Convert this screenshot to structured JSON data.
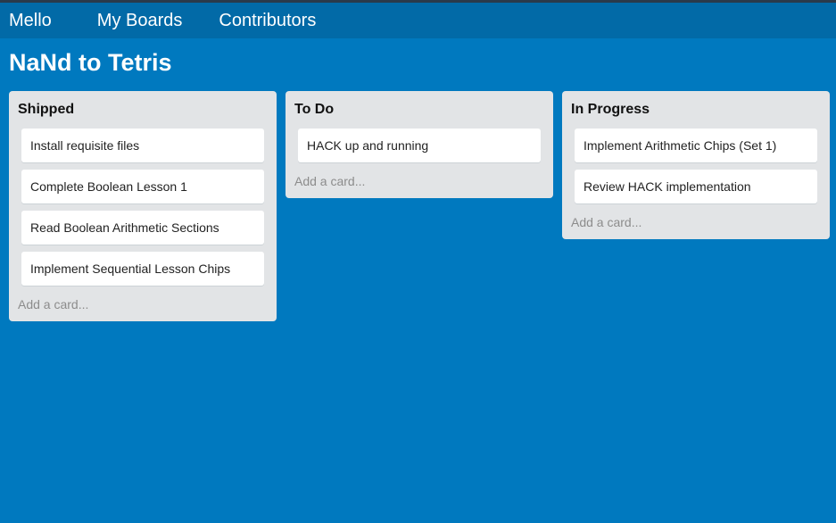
{
  "nav": {
    "brand": "Mello",
    "my_boards": "My Boards",
    "contributors": "Contributors"
  },
  "board": {
    "title": "NaNd to Tetris"
  },
  "lists": [
    {
      "title": "Shipped",
      "cards": [
        "Install requisite files",
        "Complete Boolean Lesson 1",
        "Read Boolean Arithmetic Sections",
        "Implement Sequential Lesson Chips"
      ],
      "add_card": "Add a card..."
    },
    {
      "title": "To Do",
      "cards": [
        "HACK up and running"
      ],
      "add_card": "Add a card..."
    },
    {
      "title": "In Progress",
      "cards": [
        "Implement Arithmetic Chips (Set 1)",
        "Review HACK implementation"
      ],
      "add_card": "Add a card..."
    }
  ],
  "colors": {
    "background": "#0079bf",
    "navbar": "#026aa7",
    "list": "#e2e4e6",
    "card": "#ffffff"
  }
}
